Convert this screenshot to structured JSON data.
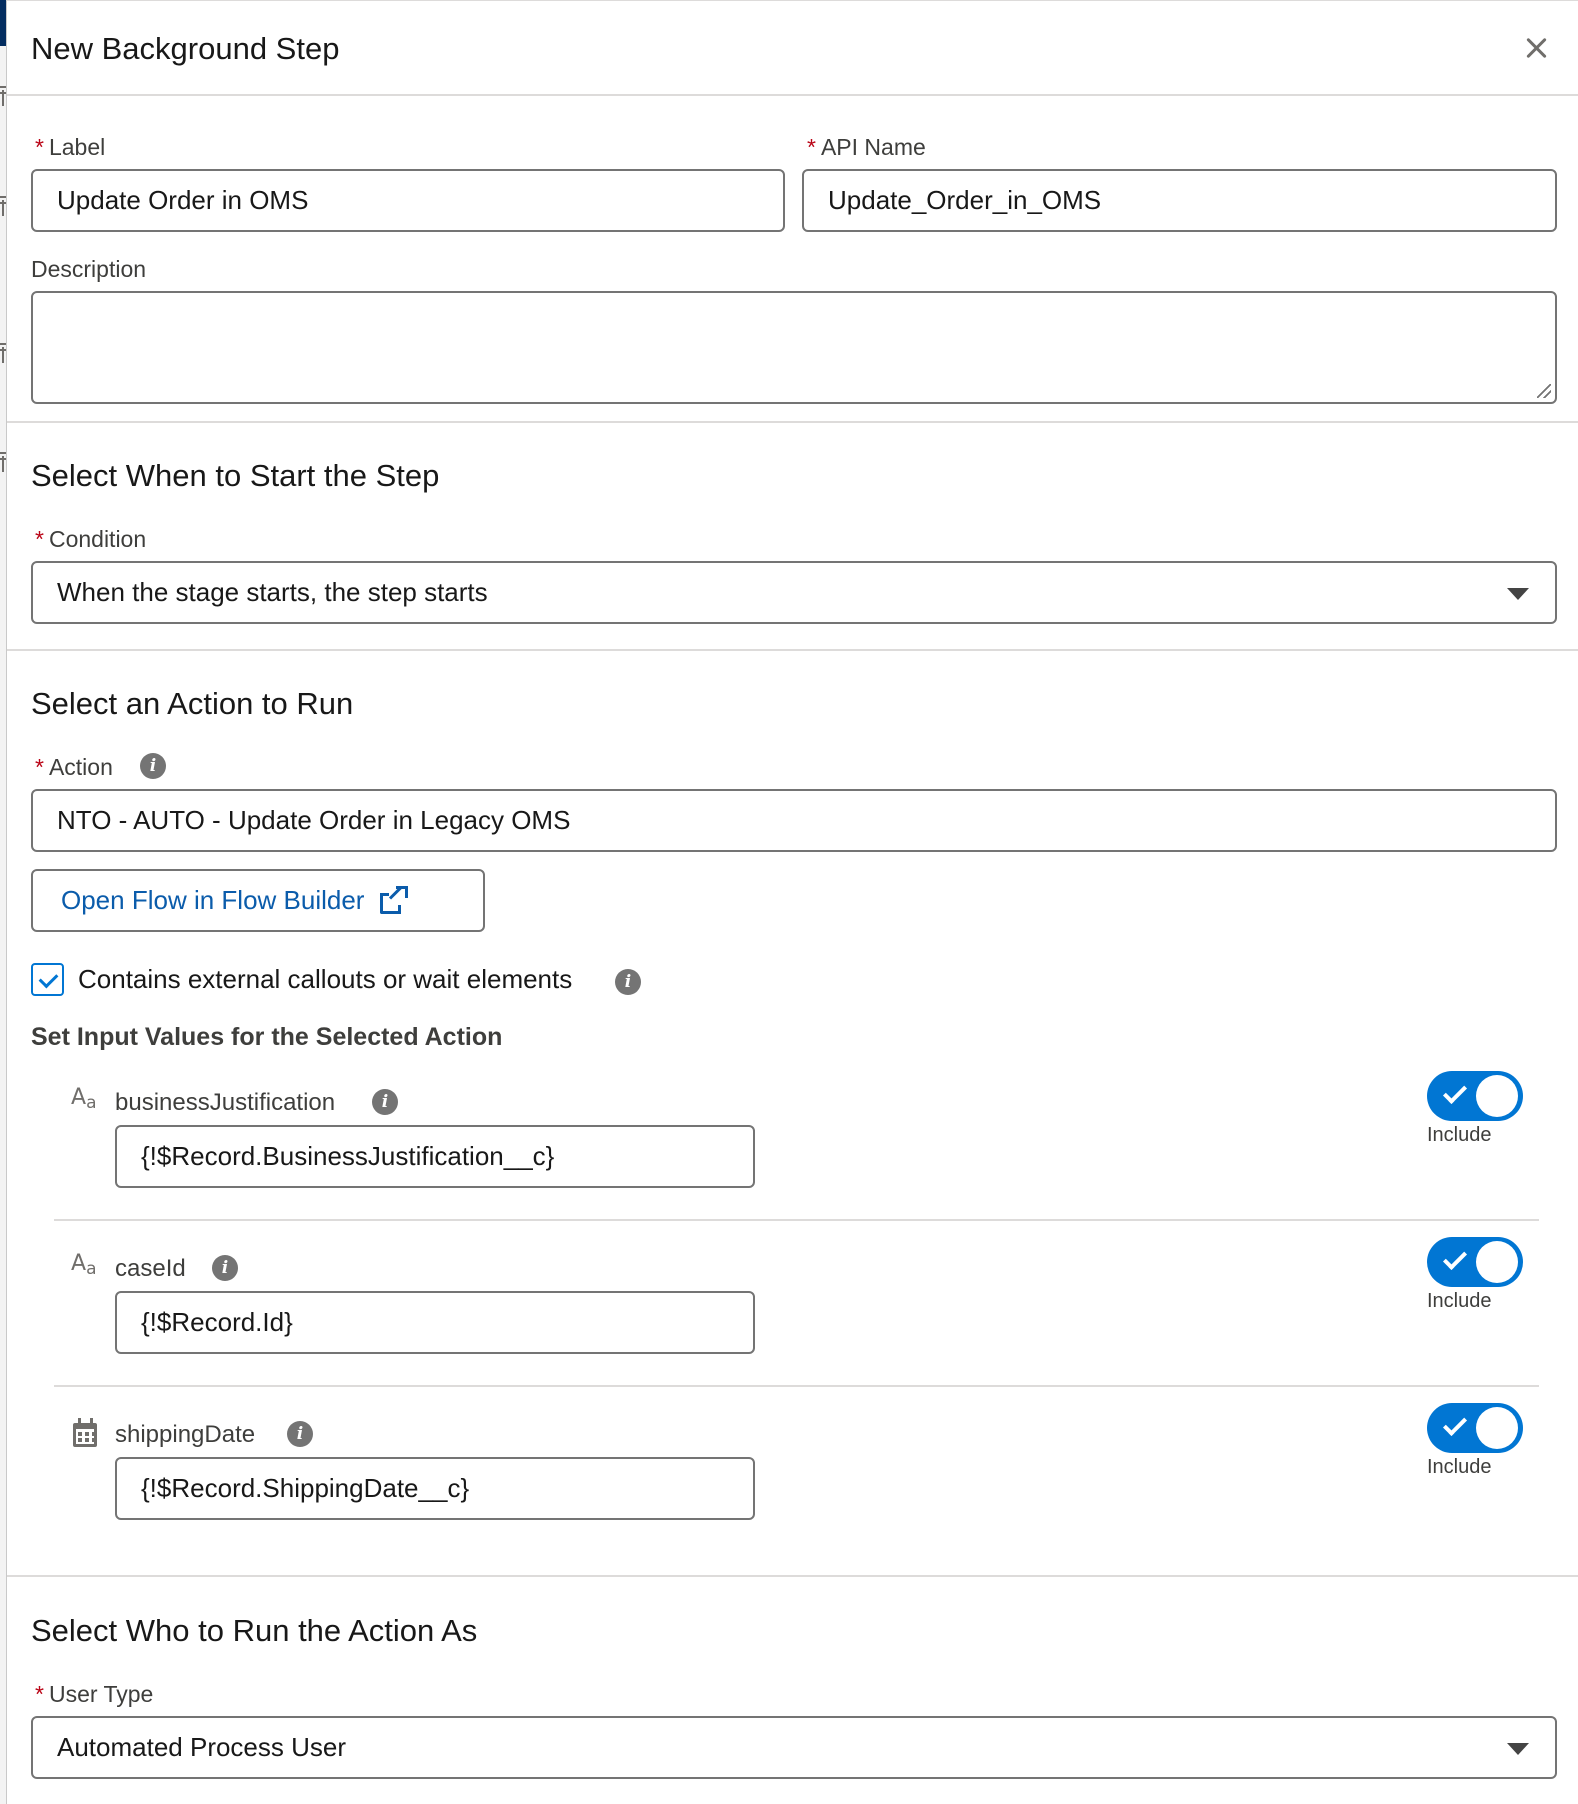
{
  "modal": {
    "title": "New Background Step",
    "close_icon": "close-icon"
  },
  "required_marker": "*",
  "fields": {
    "label": {
      "label": "Label",
      "value": "Update Order in OMS"
    },
    "api_name": {
      "label": "API Name",
      "value": "Update_Order_in_OMS"
    },
    "description": {
      "label": "Description",
      "value": ""
    }
  },
  "start_section": {
    "title": "Select When to Start the Step",
    "condition_label": "Condition",
    "condition_value": "When the stage starts, the step starts"
  },
  "action_section": {
    "title": "Select an Action to Run",
    "action_label": "Action",
    "action_value": "NTO - AUTO - Update Order in Legacy OMS",
    "open_flow_button": "Open Flow in Flow Builder",
    "callouts_checkbox_label": "Contains external callouts or wait elements",
    "callouts_checked": true,
    "inputs_heading": "Set Input Values for the Selected Action",
    "inputs": [
      {
        "type_icon": "text-type-icon",
        "name": "businessJustification",
        "value": "{!$Record.BusinessJustification__c}",
        "include_label": "Include",
        "included": true
      },
      {
        "type_icon": "text-type-icon",
        "name": "caseId",
        "value": "{!$Record.Id}",
        "include_label": "Include",
        "included": true
      },
      {
        "type_icon": "calendar-icon",
        "name": "shippingDate",
        "value": "{!$Record.ShippingDate__c}",
        "include_label": "Include",
        "included": true
      }
    ]
  },
  "run_as_section": {
    "title": "Select Who to Run the Action As",
    "user_type_label": "User Type",
    "user_type_value": "Automated Process User"
  },
  "colors": {
    "brand": "#0176d3",
    "link": "#0b5cab",
    "required": "#ba0517",
    "border": "#747474"
  }
}
